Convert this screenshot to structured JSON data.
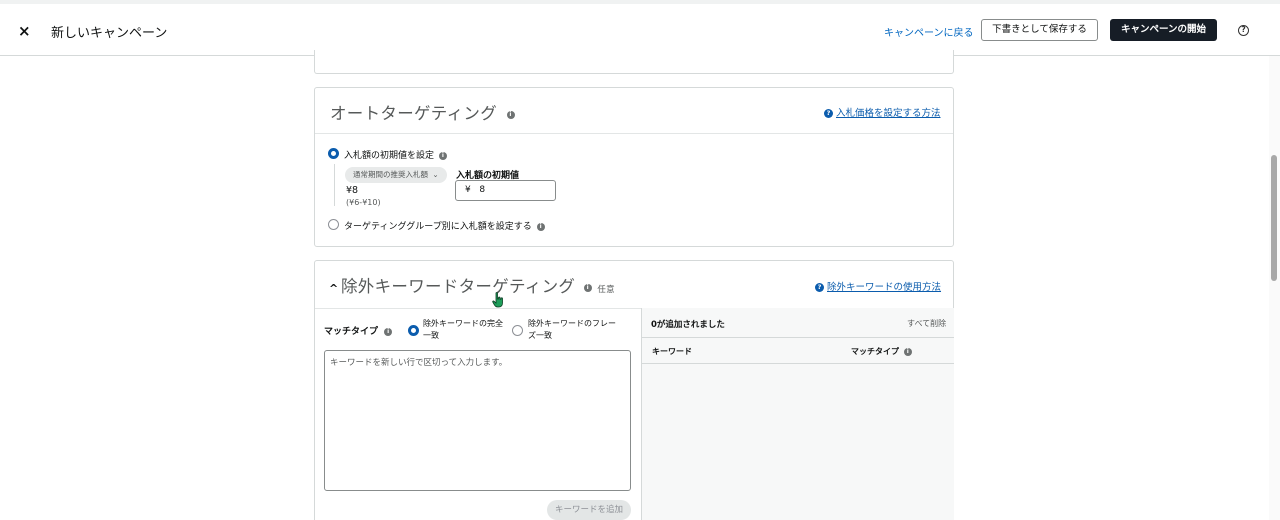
{
  "header": {
    "close_icon": "×",
    "title": "新しいキャンペーン",
    "back_link": "キャンペーンに戻る",
    "save_draft": "下書きとして保存する",
    "start_campaign": "キャンペーンの開始",
    "help_glyph": "?"
  },
  "auto_targeting": {
    "title": "オートターゲティング",
    "info_glyph": "i",
    "help_glyph": "?",
    "help_link": "入札価格を設定する方法",
    "option_default_bid": "入札額の初期値を設定",
    "suggested_pill": "通常期間の推奨入札額",
    "suggested_chevron": "⌄",
    "suggested_value": "¥8",
    "suggested_range": "(¥6-¥10)",
    "bid_label": "入札額の初期値",
    "bid_currency": "¥",
    "bid_value": "8",
    "option_group_bid": "ターゲティンググループ別に入札額を設定する"
  },
  "negative_keywords": {
    "collapse_glyph": "^",
    "title": "除外キーワードターゲティング",
    "optional": "任意",
    "help_glyph": "?",
    "help_link": "除外キーワードの使用方法",
    "match_type_label": "マッチタイプ",
    "match_exact_line1": "除外キーワードの完全",
    "match_exact_line2": "一致",
    "match_phrase_line1": "除外キーワードのフレー",
    "match_phrase_line2": "ズ一致",
    "textarea_placeholder": "キーワードを新しい行で区切って入力します。",
    "add_button": "キーワードを追加",
    "added_count": "0が追加されました",
    "remove_all": "すべて削除",
    "col_keyword": "キーワード",
    "col_match_type": "マッチタイプ",
    "selected_match": "exact"
  },
  "colors": {
    "accent": "#0b5cad",
    "primary_button": "#161d26"
  }
}
